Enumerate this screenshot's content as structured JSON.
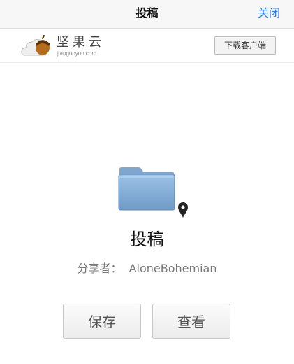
{
  "navbar": {
    "title": "投稿",
    "close_label": "关闭"
  },
  "brand": {
    "name": "坚果云",
    "url": "jianguoyun.com",
    "download_label": "下载客户端"
  },
  "folder": {
    "name": "投稿",
    "sharer_label": "分享者：",
    "sharer_name": "AloneBohemian"
  },
  "actions": {
    "save_label": "保存",
    "view_label": "查看"
  },
  "colors": {
    "accent": "#2f7cf6",
    "folder": "#7fa9d4"
  }
}
